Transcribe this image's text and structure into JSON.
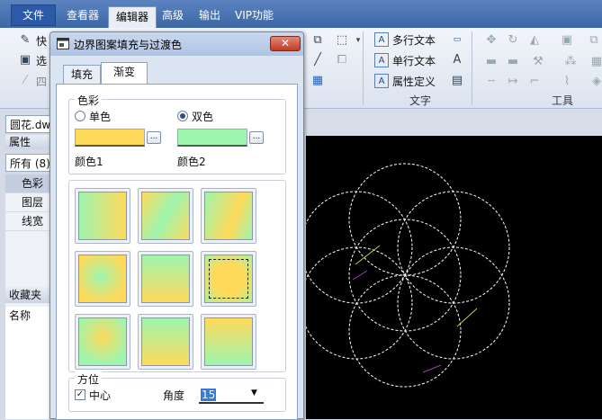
{
  "menubar": {
    "file": "文件",
    "tabs": [
      "查看器",
      "编辑器",
      "高级",
      "输出",
      "VIP功能"
    ],
    "active_tab": "编辑器"
  },
  "ribbon": {
    "left_partial": [
      "快",
      "选",
      "四"
    ],
    "text_group": {
      "items": [
        "多行文本",
        "单行文本",
        "属性定义"
      ],
      "label": "文字"
    },
    "tools_group": {
      "label": "工具"
    }
  },
  "left_panel": {
    "file_tab": "圆花.dw",
    "properties_header": "属性",
    "filter": "所有 (8)",
    "props": [
      "色彩",
      "图层",
      "线宽"
    ],
    "favorites_header": "收藏夹",
    "name_col": "名称"
  },
  "dialog": {
    "title": "边界图案填充与过渡色",
    "close": "✕",
    "tabs": [
      "填充",
      "渐变"
    ],
    "active_tab": "渐变",
    "color_group": {
      "legend": "色彩",
      "single": "单色",
      "double": "双色",
      "selected": "双色",
      "color1_label": "颜色1",
      "color2_label": "颜色2",
      "color1": "#ffd95a",
      "color2": "#9ef5ae",
      "browse": "..."
    },
    "position_group": {
      "legend": "方位",
      "center_label": "中心",
      "center_checked": true,
      "angle_label": "角度",
      "angle_value": "15"
    },
    "swatches": [
      {
        "type": "linear",
        "dir": "90deg"
      },
      {
        "type": "linear-stripe",
        "dir": "120deg"
      },
      {
        "type": "linear-stripe2",
        "dir": "110deg"
      },
      {
        "type": "radial-center"
      },
      {
        "type": "linear",
        "dir": "180deg"
      },
      {
        "type": "radial-edge",
        "selected": true
      },
      {
        "type": "radial-corner"
      },
      {
        "type": "linear-top",
        "dir": "0deg"
      },
      {
        "type": "linear",
        "dir": "0deg"
      }
    ]
  },
  "icons": {
    "dialog_icon": "window-icon",
    "dropdown": "chevron-down-icon"
  }
}
